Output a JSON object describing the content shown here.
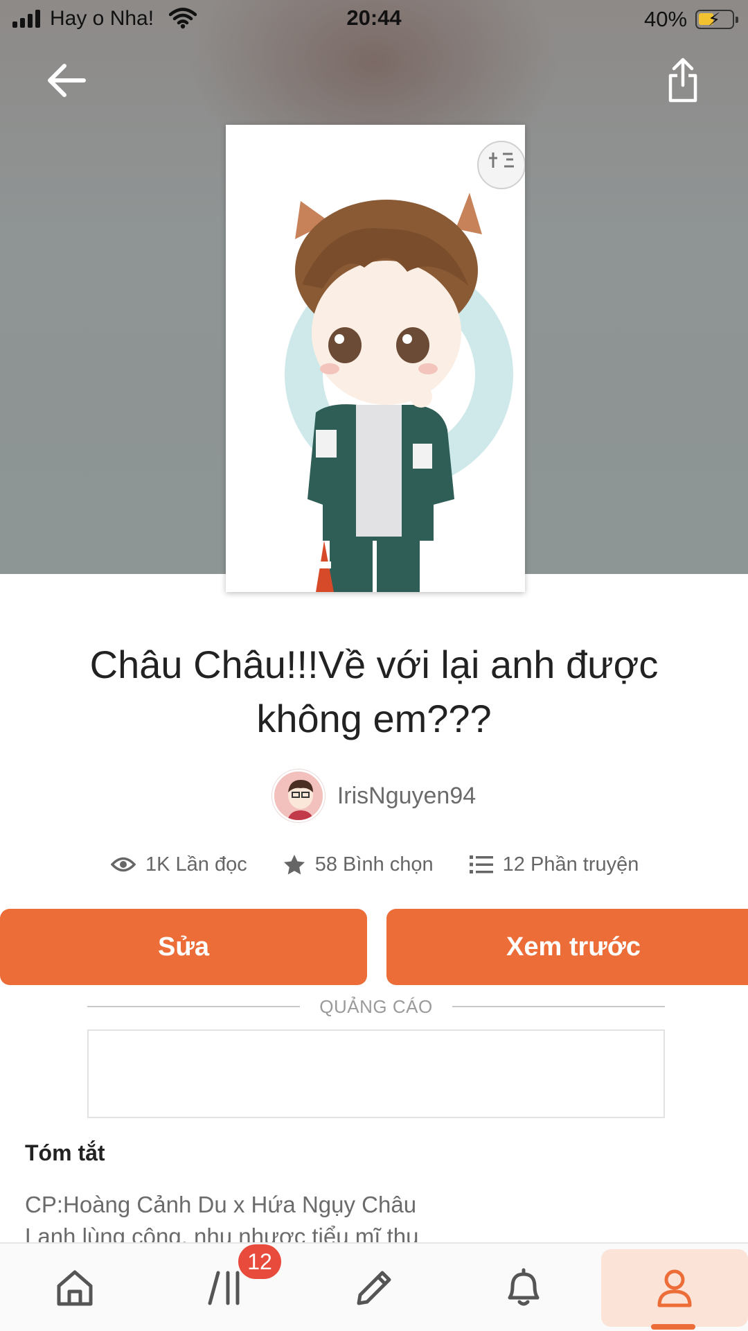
{
  "status_bar": {
    "carrier": "Hay o Nha!",
    "time": "20:44",
    "battery": "40%"
  },
  "story": {
    "title": "Châu Châu!!!Về với lại anh được không em???",
    "author": "IrisNguyen94",
    "stats": {
      "reads": "1K Lần đọc",
      "votes": "58 Bình chọn",
      "parts": "12 Phần truyện"
    }
  },
  "actions": {
    "edit": "Sửa",
    "preview": "Xem trước"
  },
  "ad": {
    "label": "QUẢNG CÁO"
  },
  "summary": {
    "heading": "Tóm tắt",
    "line1": "CP:Hoàng Cảnh Du x  Hứa Ngụy Châu",
    "line2": "Lạnh lùng công, nhu nhược tiểu mĩ thụ"
  },
  "nav": {
    "items": [
      {
        "icon": "home-icon"
      },
      {
        "icon": "library-icon"
      },
      {
        "icon": "pencil-icon"
      },
      {
        "icon": "bell-icon"
      },
      {
        "icon": "profile-icon"
      }
    ],
    "library_badge": "12",
    "active": "profile"
  },
  "colors": {
    "accent": "#ec6d38",
    "badge": "#e84a3c",
    "active_tab_bg": "#fbe3d8"
  }
}
